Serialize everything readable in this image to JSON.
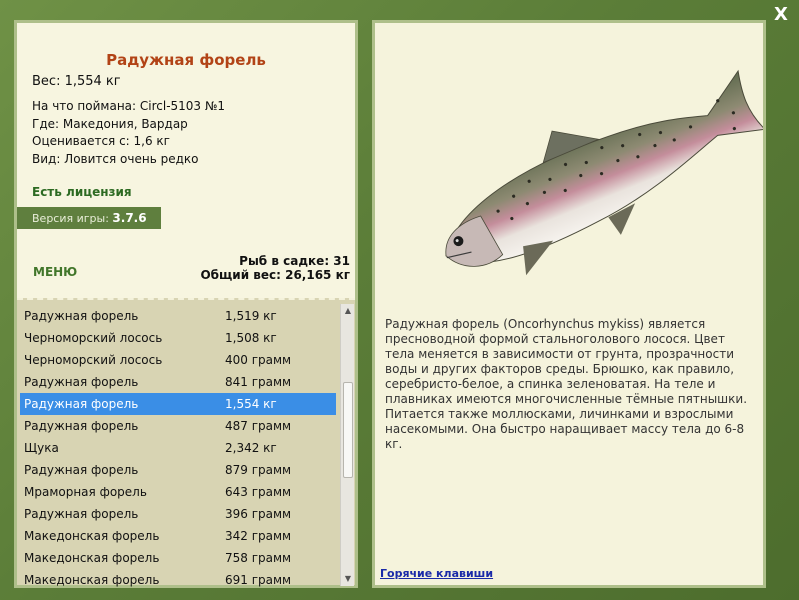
{
  "window": {
    "close_label": "X"
  },
  "fish": {
    "title": "Радужная форель",
    "weight": "Вес: 1,554 кг",
    "details": [
      "На что поймана: Circl-5103 №1",
      "Где: Македония, Вардар",
      "Оценивается с: 1,6 кг",
      "Вид: Ловится очень редко"
    ],
    "license": "Есть лицензия"
  },
  "version": {
    "label": "Версия игры:",
    "value": "3.7.6"
  },
  "menu_label": "МЕНЮ",
  "stats": {
    "count": "Рыб в садке: 31",
    "total_weight": "Общий вес: 26,165 кг"
  },
  "catch_list": [
    {
      "name": "Радужная форель",
      "weight": "1,519 кг"
    },
    {
      "name": "Черноморский лосось",
      "weight": "1,508 кг"
    },
    {
      "name": "Черноморский лосось",
      "weight": "400 грамм"
    },
    {
      "name": "Радужная форель",
      "weight": "841 грамм"
    },
    {
      "name": "Радужная форель",
      "weight": "1,554 кг"
    },
    {
      "name": "Радужная форель",
      "weight": "487 грамм"
    },
    {
      "name": "Щука",
      "weight": "2,342 кг"
    },
    {
      "name": "Радужная форель",
      "weight": "879 грамм"
    },
    {
      "name": "Мраморная форель",
      "weight": "643 грамм"
    },
    {
      "name": "Радужная форель",
      "weight": "396 грамм"
    },
    {
      "name": "Македонская форель",
      "weight": "342 грамм"
    },
    {
      "name": "Македонская форель",
      "weight": "758 грамм"
    },
    {
      "name": "Македонская форель",
      "weight": "691 грамм"
    }
  ],
  "selected_index": 4,
  "description": "Радужная форель (Oncorhynchus mykiss) является пресноводной формой стальноголового лосося. Цвет тела меняется в зависимости от грунта, прозрачности воды и других факторов среды. Брюшко, как правило, серебристо-белое, а спинка зеленоватая. На теле и плавниках имеются многочисленные тёмные пятнышки. Питается также моллюсками, личинками и взрослыми насекомыми. Она быстро наращивает массу тела до 6-8 кг.",
  "hotkeys_label": "Горячие клавиши",
  "colors": {
    "frame": "#587a36",
    "panel": "#f5f3dc",
    "title": "#b24316",
    "license": "#2d6a22",
    "selection": "#3a8ee6",
    "link": "#1a2aa8"
  }
}
